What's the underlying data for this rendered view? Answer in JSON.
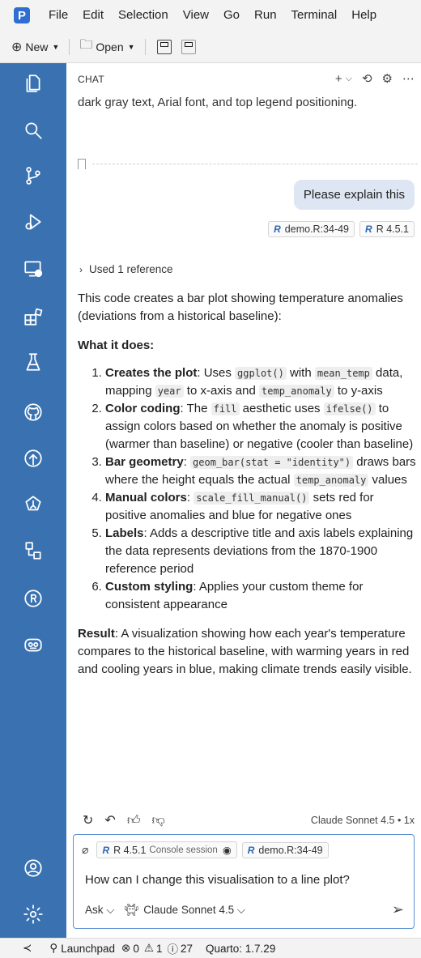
{
  "menubar": {
    "logo": "P",
    "items": [
      "File",
      "Edit",
      "Selection",
      "View",
      "Go",
      "Run",
      "Terminal",
      "Help"
    ]
  },
  "toolbar": {
    "new_label": "New",
    "open_label": "Open"
  },
  "activity_icons": [
    "explorer-icon",
    "search-icon",
    "source-control-icon",
    "run-debug-icon",
    "remote-explorer-icon",
    "extensions-icon",
    "testing-icon",
    "github-icon",
    "publish-icon",
    "environments-icon",
    "workflow-icon",
    "r-console-icon",
    "copilot-icon",
    "account-icon",
    "settings-icon"
  ],
  "chat": {
    "title": "CHAT",
    "previous_text": "dark gray text, Arial font, and top legend positioning.",
    "user_message": "Please explain this",
    "user_chips": [
      "demo.R:34-49",
      "R 4.5.1"
    ],
    "used_reference": "Used 1 reference",
    "intro": "This code creates a bar plot showing temperature anomalies (deviations from a historical baseline):",
    "what_heading": "What it does:",
    "steps": [
      {
        "title": "Creates the plot",
        "parts": [
          ": Uses ",
          "#ggplot()",
          " with ",
          "#mean_temp",
          " data, mapping ",
          "#year",
          " to x-axis and ",
          "#temp_anomaly",
          " to y-axis"
        ]
      },
      {
        "title": "Color coding",
        "parts": [
          ": The ",
          "#fill",
          " aesthetic uses ",
          "#ifelse()",
          " to assign colors based on whether the anomaly is positive (warmer than baseline) or negative (cooler than baseline)"
        ]
      },
      {
        "title": "Bar geometry",
        "parts": [
          ": ",
          "#geom_bar(stat = \"identity\")",
          " draws bars where the height equals the actual ",
          "#temp_anomaly",
          " values"
        ]
      },
      {
        "title": "Manual colors",
        "parts": [
          ": ",
          "#scale_fill_manual()",
          " sets red for positive anomalies and blue for negative ones"
        ]
      },
      {
        "title": "Labels",
        "parts": [
          ": Adds a descriptive title and axis labels explaining the data represents deviations from the 1870-1900 reference period"
        ]
      },
      {
        "title": "Custom styling",
        "parts": [
          ": Applies your custom theme for consistent appearance"
        ]
      }
    ],
    "result_label": "Result",
    "result_text": ": A visualization showing how each year's temperature compares to the historical baseline, with warming years in red and cooling years in blue, making climate trends easily visible.",
    "model_info": "Claude Sonnet 4.5 • 1x"
  },
  "input": {
    "chip_r_version": "R 4.5.1",
    "chip_r_sub": "Console session",
    "chip_file": "demo.R:34-49",
    "text": "How can I change this visualisation to a line plot?",
    "mode": "Ask",
    "model": "Claude Sonnet 4.5"
  },
  "statusbar": {
    "launchpad": "Launchpad",
    "errors": "0",
    "warnings": "1",
    "infos": "27",
    "quarto": "Quarto: 1.7.29"
  }
}
